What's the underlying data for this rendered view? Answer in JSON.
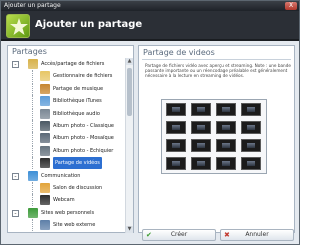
{
  "window": {
    "title": "Ajouter un partage",
    "close_label": "X"
  },
  "header": {
    "title": "Ajouter un partage"
  },
  "left_panel": {
    "title": "Partages",
    "tree": [
      {
        "label": "Accès/partage de fichiers",
        "level": 0,
        "icon": "share-folder-icon",
        "color": "#d7b24a",
        "expander": "-"
      },
      {
        "label": "Gestionnaire de fichiers",
        "level": 1,
        "icon": "file-manager-icon",
        "color": "#e7c665"
      },
      {
        "label": "Partage de musique",
        "level": 1,
        "icon": "music-icon",
        "color": "#c6862f"
      },
      {
        "label": "Bibliothèque iTunes",
        "level": 1,
        "icon": "itunes-icon",
        "color": "#5a9bd8"
      },
      {
        "label": "Bibliothèque audio",
        "level": 1,
        "icon": "audio-library-icon",
        "color": "#7a8794"
      },
      {
        "label": "Album photo - Classique",
        "level": 1,
        "icon": "photo-album-icon",
        "color": "#4a5864"
      },
      {
        "label": "Album photo - Mosaïque",
        "level": 1,
        "icon": "photo-mosaic-icon",
        "color": "#5a6877"
      },
      {
        "label": "Album photo - Echiquier",
        "level": 1,
        "icon": "photo-chessboard-icon",
        "color": "#66737f"
      },
      {
        "label": "Partage de vidéos",
        "level": 1,
        "icon": "video-icon",
        "color": "#2c2c2c",
        "selected": true
      },
      {
        "label": "Communication",
        "level": 0,
        "icon": "communication-icon",
        "color": "#3c8fd6",
        "expander": "-"
      },
      {
        "label": "Salon de discussion",
        "level": 1,
        "icon": "chat-icon",
        "color": "#e2a43a"
      },
      {
        "label": "Webcam",
        "level": 1,
        "icon": "webcam-icon",
        "color": "#2e2e2e"
      },
      {
        "label": "Sites web personnels",
        "level": 0,
        "icon": "websites-icon",
        "color": "#3d9b3a",
        "expander": "-"
      },
      {
        "label": "Site web externe",
        "level": 1,
        "icon": "external-site-icon",
        "color": "#5d7fa8"
      }
    ]
  },
  "right_panel": {
    "title": "Partage de videos",
    "description": "Partage de fichiers vidéo avec aperçu et streaming. Note : une bande passante importante ou un réencodage préalable est généralement nécessaire à la lecture en streaming de vidéos."
  },
  "buttons": {
    "create_label": "Créer",
    "cancel_label": "Annuler"
  }
}
